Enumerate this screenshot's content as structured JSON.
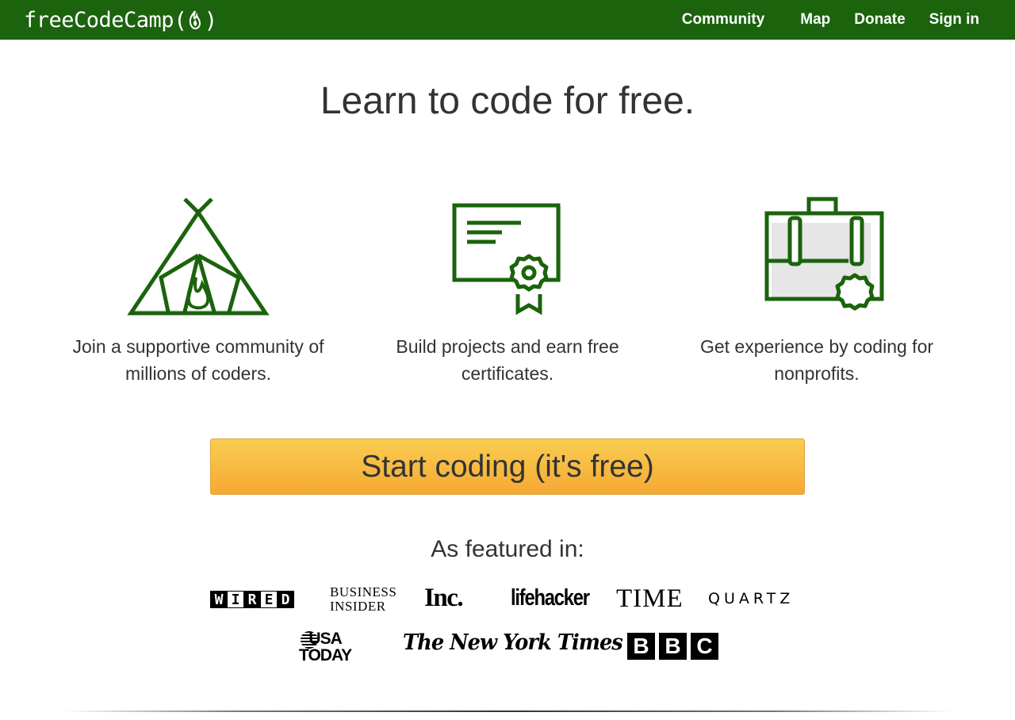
{
  "nav": {
    "logo_text": "freeCodeCamp",
    "logo_open": "(",
    "logo_close": ")",
    "links": [
      "Community",
      "Map",
      "Donate",
      "Sign in"
    ],
    "background": "#1b630d"
  },
  "hero": {
    "title": "Learn to code for free.",
    "features": [
      {
        "icon": "campfire-tent-icon",
        "caption": "Join a supportive community of millions of coders."
      },
      {
        "icon": "certificate-icon",
        "caption": "Build projects and earn free certificates."
      },
      {
        "icon": "briefcase-icon",
        "caption": "Get experience by coding for nonprofits."
      }
    ],
    "cta_label": "Start coding (it's free)",
    "accent": "#f5a933"
  },
  "featured": {
    "title": "As featured in:",
    "press": {
      "wired": [
        "W",
        "I",
        "R",
        "E",
        "D"
      ],
      "business_insider_1": "BUSINESS",
      "business_insider_2": "INSIDER",
      "inc": "Inc.",
      "lifehacker": "lifehacker",
      "time": "TIME",
      "quartz": "QUARTZ",
      "usa_1": "USA",
      "usa_2": "TODAY",
      "nyt": "The New York Times",
      "bbc": [
        "B",
        "B",
        "C"
      ]
    }
  }
}
